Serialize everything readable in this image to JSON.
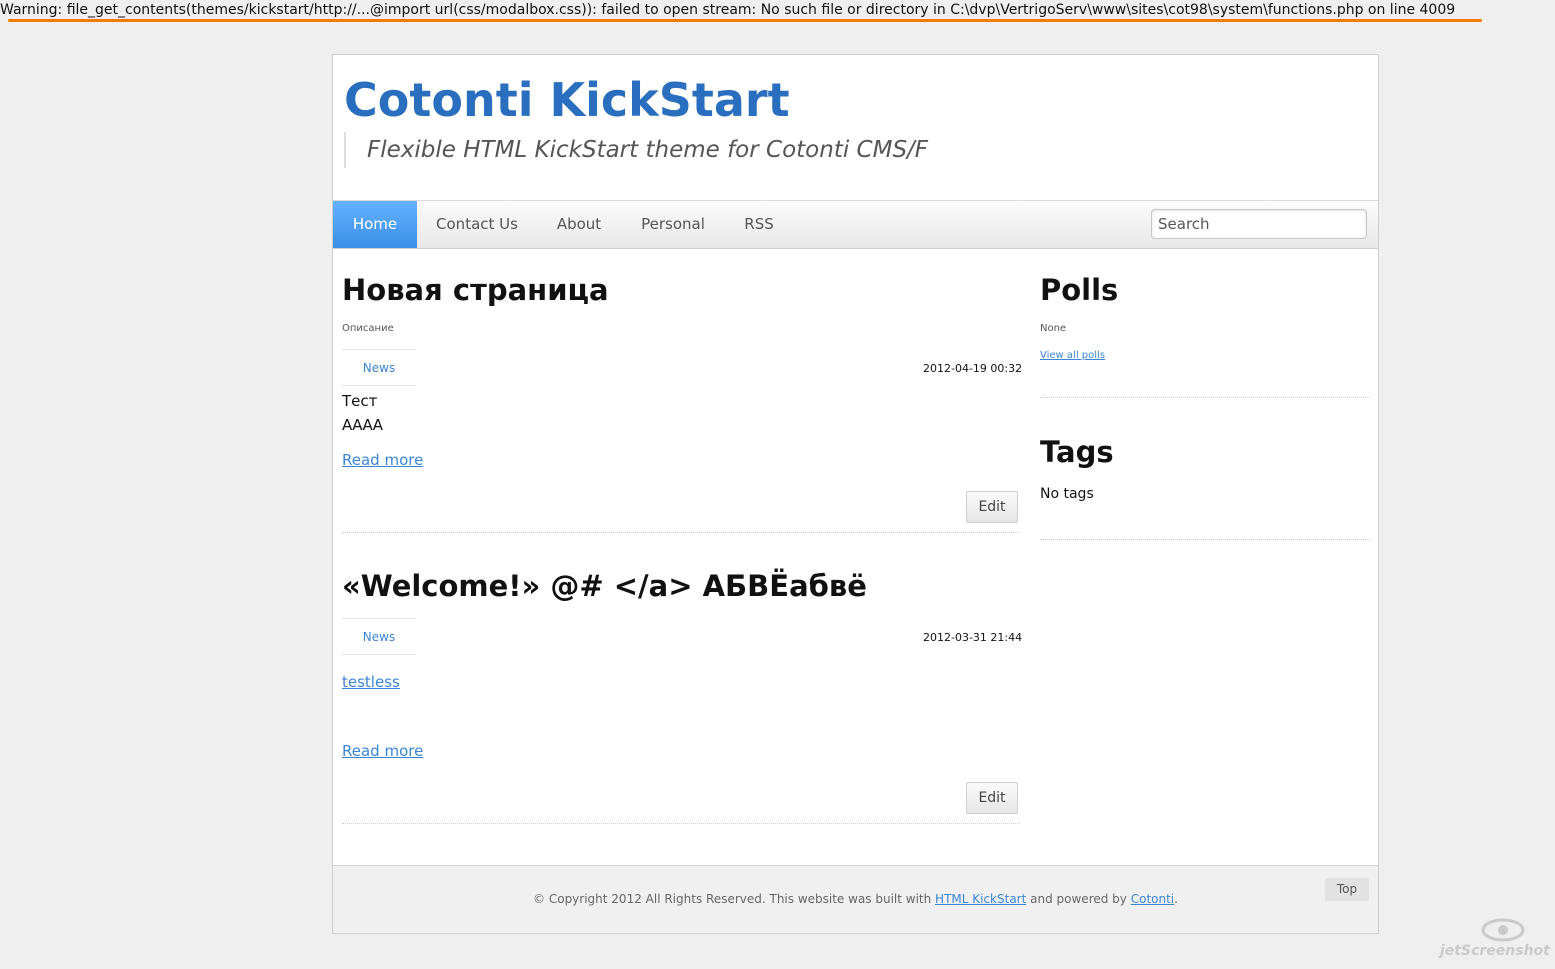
{
  "warning": {
    "text": "Warning: file_get_contents(themes/kickstart/http://...@import url(css/modalbox.css)): failed to open stream: No such file or directory in C:\\dvp\\VertrigoServ\\www\\sites\\cot98\\system\\functions.php on line 4009"
  },
  "header": {
    "title": "Cotonti KickStart",
    "tagline": "Flexible HTML KickStart theme for Cotonti CMS/F"
  },
  "nav": {
    "items": [
      "Home",
      "Contact Us",
      "About",
      "Personal",
      "RSS"
    ],
    "active": "Home",
    "search_placeholder": "Search"
  },
  "posts": [
    {
      "title": "Новая страница",
      "description": "Описание",
      "category": "News",
      "date": "2012-04-19 00:32",
      "body": [
        "Тест",
        "АААА"
      ],
      "read_more": "Read more",
      "edit": "Edit"
    },
    {
      "title": "«Welcome!» @# </a> АБВЁабвё",
      "category": "News",
      "date": "2012-03-31 21:44",
      "body_link": "testless",
      "read_more": "Read more",
      "edit": "Edit"
    }
  ],
  "sidebar": {
    "polls": {
      "title": "Polls",
      "text": "None",
      "link": "View all polls"
    },
    "tags": {
      "title": "Tags",
      "text": "No tags"
    }
  },
  "footer": {
    "text_before": "© Copyright 2012 All Rights Reserved.  This website was built with ",
    "link1": "HTML KickStart",
    "text_middle": " and powered by ",
    "link2": "Cotonti",
    "text_after": ".",
    "top_button": "Top"
  },
  "watermark": {
    "text": "jetScreenshot"
  },
  "colors": {
    "accent": "#2a6fbf",
    "link": "#3a86d6",
    "warning_underline": "#f07d00",
    "nav_active": "#3a8fe8"
  }
}
